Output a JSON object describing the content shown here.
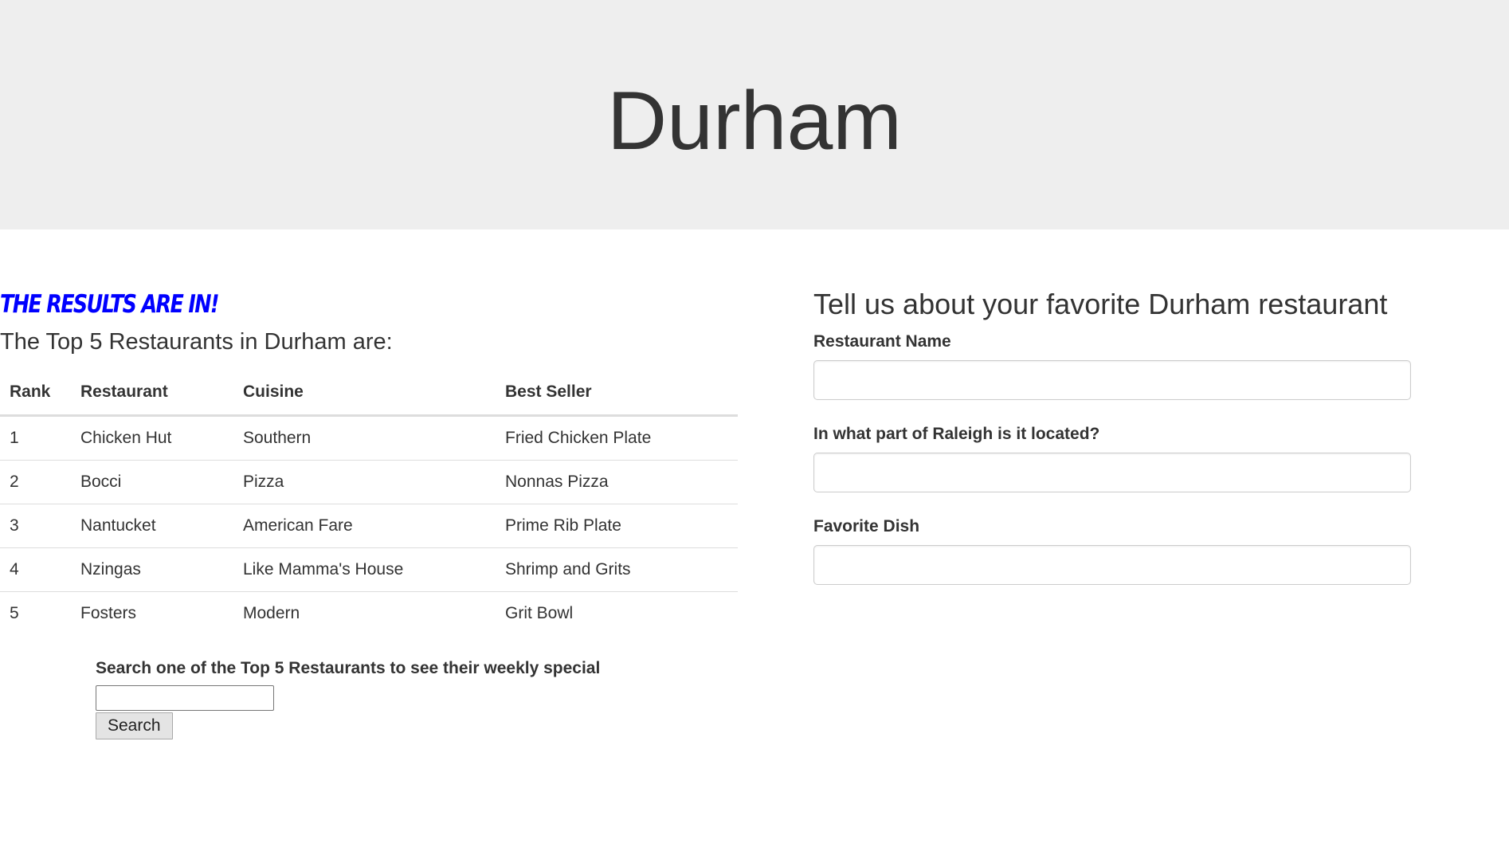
{
  "hero": {
    "title": "Durham"
  },
  "results": {
    "heading": "The Results Are In!",
    "subheading": "The Top 5 Restaurants in Durham are:",
    "heading_color": "#0000ff",
    "columns": [
      "Rank",
      "Restaurant",
      "Cuisine",
      "Best Seller"
    ],
    "rows": [
      [
        "1",
        "Chicken Hut",
        "Southern",
        "Fried Chicken Plate"
      ],
      [
        "2",
        "Bocci",
        "Pizza",
        "Nonnas Pizza"
      ],
      [
        "3",
        "Nantucket",
        "American Fare",
        "Prime Rib Plate"
      ],
      [
        "4",
        "Nzingas",
        "Like Mamma's House",
        "Shrimp and Grits"
      ],
      [
        "5",
        "Fosters",
        "Modern",
        "Grit Bowl"
      ]
    ]
  },
  "search": {
    "label": "Search one of the Top 5 Restaurants to see their weekly special",
    "value": "",
    "button_label": "Search"
  },
  "form": {
    "title": "Tell us about your favorite Durham restaurant",
    "fields": [
      {
        "label": "Restaurant Name",
        "value": ""
      },
      {
        "label": "In what part of Raleigh is it located?",
        "value": ""
      },
      {
        "label": "Favorite Dish",
        "value": ""
      }
    ]
  }
}
